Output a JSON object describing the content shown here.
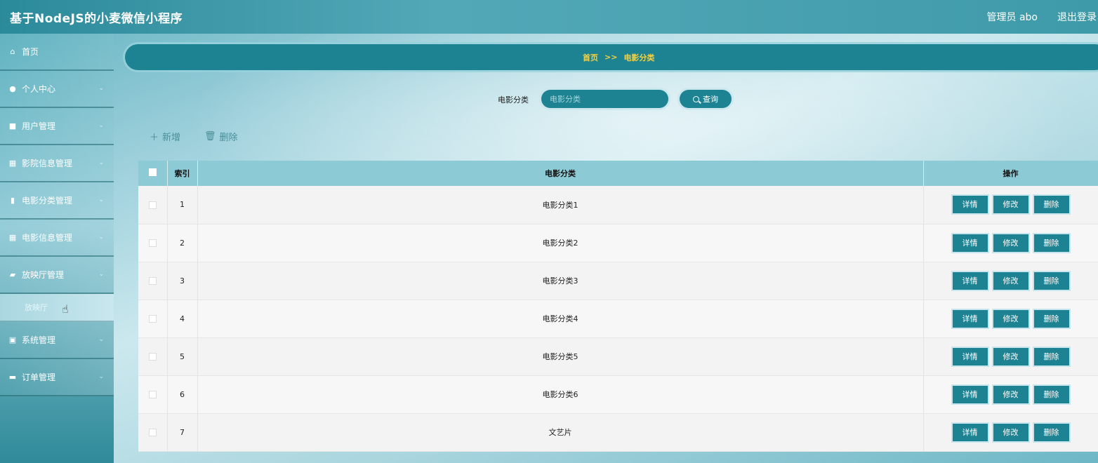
{
  "header": {
    "title": "基于NodeJS的小麦微信小程序",
    "user": "管理员 abo",
    "logout": "退出登录"
  },
  "sidebar": {
    "items": [
      {
        "label": "首页",
        "icon": "home-icon",
        "glyph": "⌂",
        "chevron": false
      },
      {
        "label": "个人中心",
        "icon": "user-icon",
        "glyph": "●",
        "chevron": true
      },
      {
        "label": "用户管理",
        "icon": "user-admin-icon",
        "glyph": "■",
        "chevron": true
      },
      {
        "label": "影院信息管理",
        "icon": "grid-icon",
        "glyph": "▦",
        "chevron": true
      },
      {
        "label": "电影分类管理",
        "icon": "bar-chart-icon",
        "glyph": "▮",
        "chevron": true
      },
      {
        "label": "电影信息管理",
        "icon": "grid-icon",
        "glyph": "▦",
        "chevron": true
      },
      {
        "label": "放映厅管理",
        "icon": "thumbs-icon",
        "glyph": "▰",
        "chevron": true
      }
    ],
    "submenu": {
      "label": "放映厅"
    },
    "items_after": [
      {
        "label": "系统管理",
        "icon": "clipboard-icon",
        "glyph": "▣",
        "chevron": true
      },
      {
        "label": "订单管理",
        "icon": "monitor-icon",
        "glyph": "▬",
        "chevron": true
      }
    ]
  },
  "breadcrumb": {
    "home": "首页",
    "sep": ">>",
    "current": "电影分类"
  },
  "search": {
    "label": "电影分类",
    "placeholder": "电影分类",
    "button": "查询"
  },
  "actions": {
    "add": "新增",
    "delete": "删除"
  },
  "table": {
    "headers": {
      "index": "索引",
      "category": "电影分类",
      "ops": "操作"
    },
    "rows": [
      {
        "index": "1",
        "category": "电影分类1"
      },
      {
        "index": "2",
        "category": "电影分类2"
      },
      {
        "index": "3",
        "category": "电影分类3"
      },
      {
        "index": "4",
        "category": "电影分类4"
      },
      {
        "index": "5",
        "category": "电影分类5"
      },
      {
        "index": "6",
        "category": "电影分类6"
      },
      {
        "index": "7",
        "category": "文艺片"
      }
    ],
    "ops": {
      "detail": "详情",
      "edit": "修改",
      "delete": "删除"
    }
  },
  "colors": {
    "accent": "#1d8392",
    "breadcrumb_text": "#f5d142",
    "header_row": "#8ccbd6"
  }
}
